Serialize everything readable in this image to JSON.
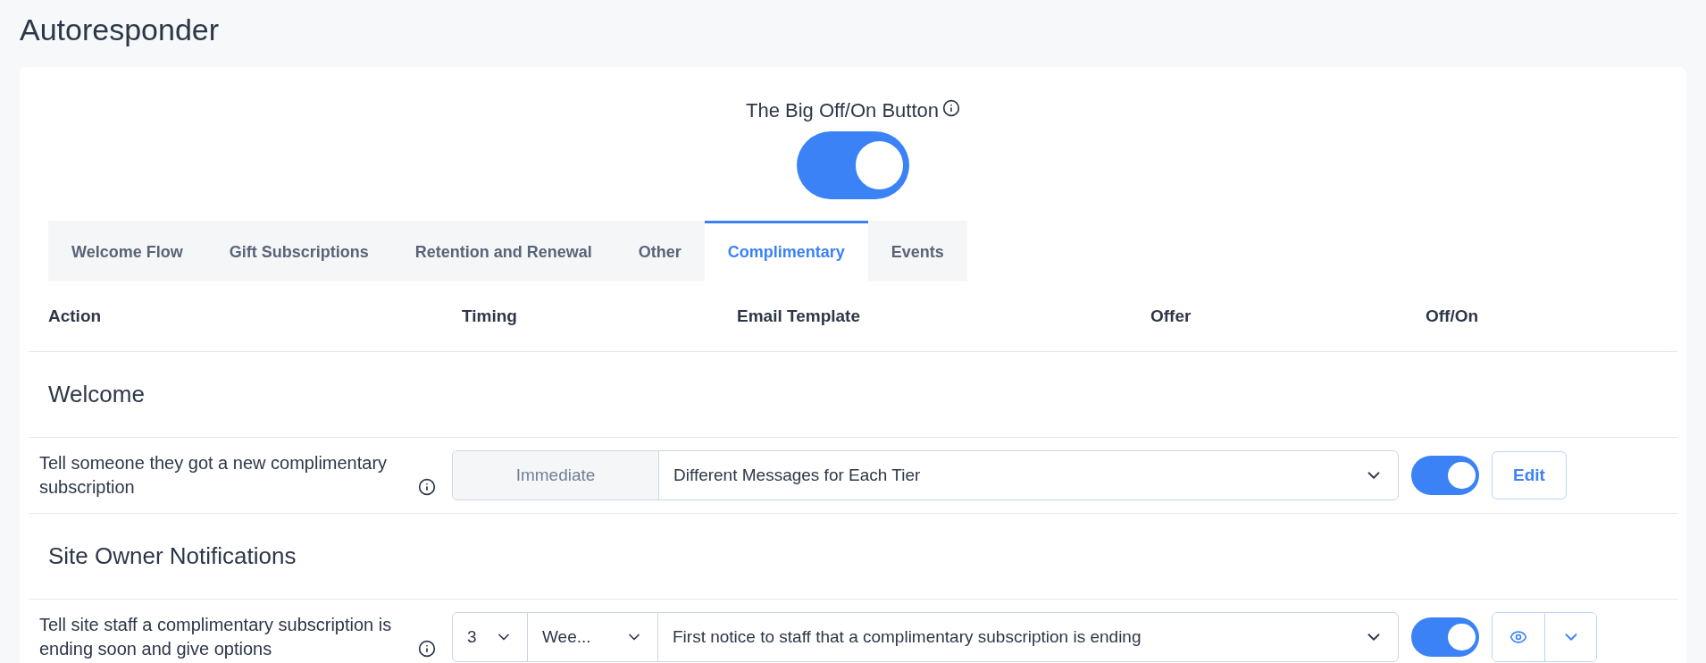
{
  "page": {
    "title": "Autoresponder"
  },
  "master": {
    "label": "The Big Off/On Button",
    "on": true
  },
  "tabs": [
    {
      "label": "Welcome Flow",
      "selected": false
    },
    {
      "label": "Gift Subscriptions",
      "selected": false
    },
    {
      "label": "Retention and Renewal",
      "selected": false
    },
    {
      "label": "Other",
      "selected": false
    },
    {
      "label": "Complimentary",
      "selected": true
    },
    {
      "label": "Events",
      "selected": false
    }
  ],
  "columns": [
    "Action",
    "Timing",
    "Email Template",
    "Offer",
    "Off/On"
  ],
  "sections": [
    {
      "title": "Welcome",
      "rows": [
        {
          "action": "Tell someone they got a new complimentary subscription",
          "timing": {
            "kind": "fixed",
            "value": "Immediate"
          },
          "template": "Different Messages for Each Tier",
          "on": true,
          "controls": {
            "kind": "edit",
            "label": "Edit"
          }
        }
      ]
    },
    {
      "title": "Site Owner Notifications",
      "rows": [
        {
          "action": "Tell site staff a complimentary subscription is ending soon and give options",
          "timing": {
            "kind": "interval",
            "amount": "3",
            "unit": "Wee..."
          },
          "template": "First notice to staff that a complimentary subscription is ending",
          "on": true,
          "controls": {
            "kind": "preview"
          }
        }
      ]
    }
  ]
}
